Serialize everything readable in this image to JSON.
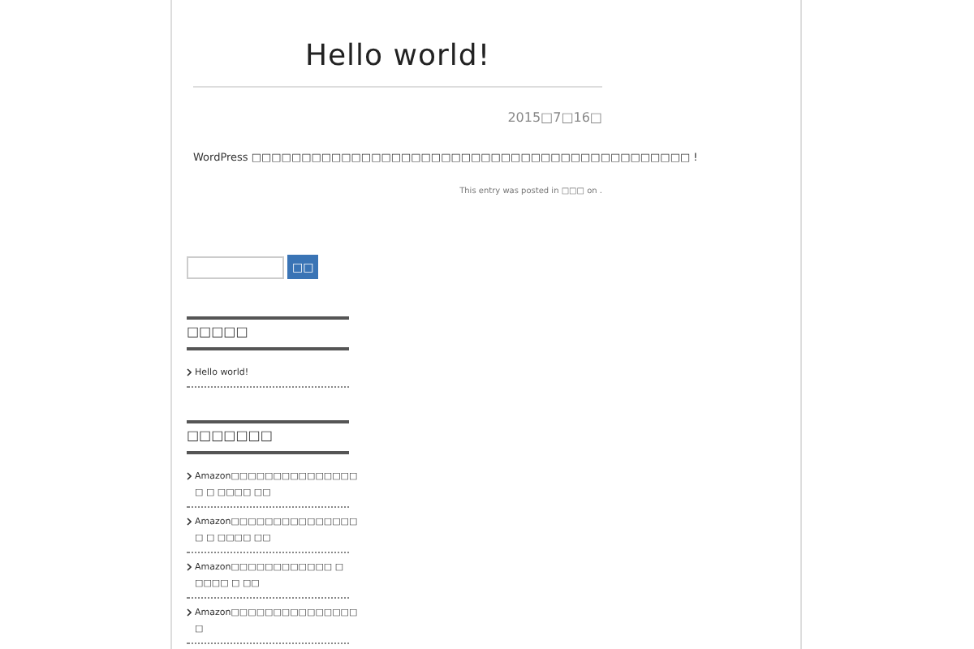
{
  "post": {
    "title": "Hello world!",
    "date": "2015□7□16□",
    "body": "WordPress □□□□□□□□□□□□□□□□□□□□□□□□□□□□□□□□□□□□□□□□□□□□ !",
    "meta": "This entry was posted in □□□ on ."
  },
  "search": {
    "button": "□□"
  },
  "widgets": [
    {
      "title": "□□□□□",
      "items": [
        "Hello world!"
      ]
    },
    {
      "title": "□□□□□□□",
      "items": [
        "Amazon□□□□□□□□□□□□□□□ □ □ □□□□ □□",
        "Amazon□□□□□□□□□□□□□□□ □ □ □□□□ □□",
        "Amazon□□□□□□□□□□□□ □ □□□□ □ □□",
        "Amazon□□□□□□□□□□□□□□□ □"
      ]
    }
  ]
}
